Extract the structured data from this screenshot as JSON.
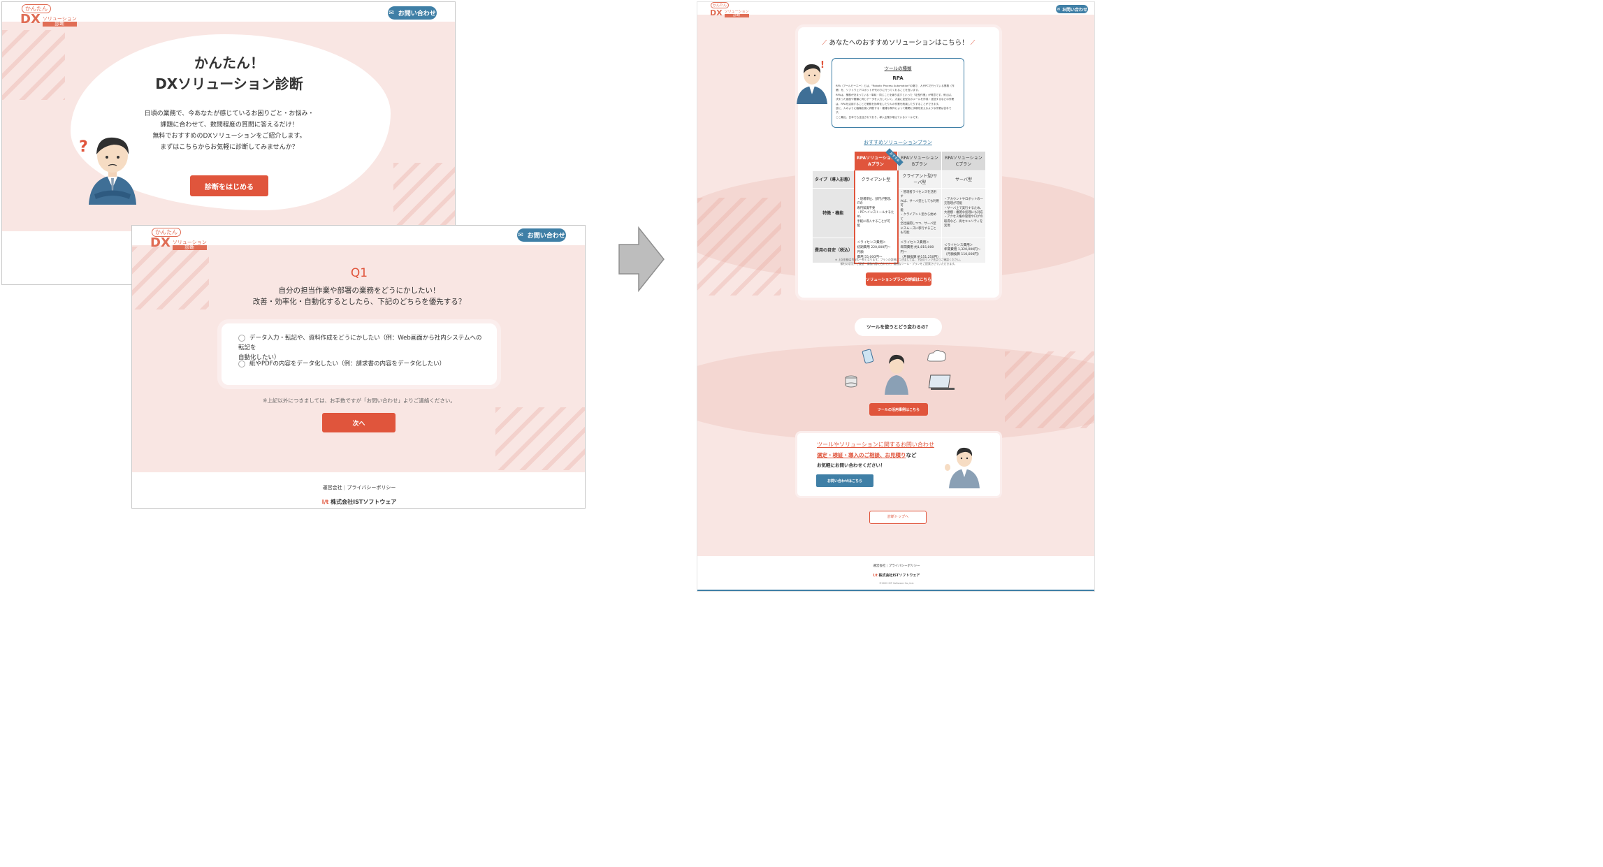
{
  "colors": {
    "accent": "#e0553c",
    "brand_blue": "#3f7fa6",
    "pink_bg": "#f9e6e3",
    "arrow_gray": "#bdbdbd"
  },
  "logo": {
    "tag": "かんたん",
    "dx": "DX",
    "line1": "ソリューション",
    "line2": "診断"
  },
  "contact_label": "お問い合わせ",
  "screen1": {
    "title_line1": "かんたん！",
    "title_line2": "DXソリューション診断",
    "body_lines": [
      "日頃の業務で、今あなたが感じているお困りごと・お悩み・",
      "課題に合わせて、数問程度の質問に答えるだけ！",
      "無料でおすすめのDXソリューションをご紹介します。",
      "まずはこちらからお気軽に診断してみませんか？"
    ],
    "start_button": "診断をはじめる"
  },
  "screen2": {
    "q_number": "Q1",
    "q_line1": "自分の担当作業や部署の業務をどうにかしたい！",
    "q_line2": "改善・効率化・自動化するとしたら、下記のどちらを優先する？",
    "option1_a": "データ入力・転記や、資料作成をどうにかしたい（例：Web画面から社内システムへの転記を",
    "option1_b": "自動化したい）",
    "option2": "紙やPDFの内容をデータ化したい（例：請求書の内容をデータ化したい）",
    "note": "※上記以外につきましては、お手数ですが「お問い合わせ」よりご連絡ください。",
    "next_button": "次へ",
    "footer_company": "運営会社",
    "footer_privacy": "プライバシーポリシー",
    "footer_brand": "株式会社ISTソフトウェア"
  },
  "screen3": {
    "rec_title": "あなたへのおすすめソリューションはこちら！",
    "tool_kind_label": "ツールの種類",
    "tool_name": "RPA",
    "tool_desc": [
      "RPA（アールピーエー）とは、\"Robotic Process Automation\"の略で、人がPCで行っている業務（作",
      "業）を、ソフトウェアロボットが代わりに行ってくれることを言います。",
      "RPAは、業務が決まっている・単純・同じことを繰り返すといった「定型作業」が得意です。例えば、",
      "決まった画面や書類に同じデータを入力していく、大量に定型文のメールを作成・送信するなどの作業",
      "は、RPAを活用することで業務を効率化したり人の作業を削減したりすることができます。",
      "逆に、人のように臨機応変に判断する・複雑な条件によって難関に手順を変えるような作業は苦手で",
      "す。",
      "ここ最近、日本でも注目されており、導入企業が増えているツールです。"
    ],
    "plans_title": "おすすめソリューションプラン",
    "plan_headers": [
      "RPAソリューション\nAプラン",
      "RPAソリューション\nBプラン",
      "RPAソリューション\nCプラン"
    ],
    "recommended_badge": "おすすめ",
    "row_labels": [
      "タイプ（導入形態）",
      "特徴・機能",
      "費用の目安（税込）"
    ],
    "type_row": [
      "クライアント型",
      "クライアント型/サーバ型",
      "サーバ型"
    ],
    "feature_row": [
      "・現場単位、部門が整理、ITの\n専門知識不要\n・PCへインストールするため、\n手軽に導入することが可\n能",
      "・管理者ライセンスを活用す\nれば、サーバ型としても利用可\n能\n・クライアント型から始めて\n全社展開しつつ、サーバ型\nにスムーズに移行することも可能",
      "・アカウントやロボットの一\n元管理が可能\n・サーバ上で実行するため、\n大規模・複雑な処理にも対応\n・アクセス権の管理やログの\n取得など、高セキュリティを\n実現"
    ],
    "cost_row": [
      "＜ライセンス費用＞\n初期費用 220,000円〜 月額\n費用 55,000円〜",
      "＜ライセンス費用＞\n年間費用 約1,815,000円〜\n（月額換算 約151,250円）",
      "＜ライセンス費用＞\n年間費用 1,320,000円〜\n（月額換算 110,000円）"
    ],
    "plans_note1": "※ 上記金額は目安の一例となります。プランの詳細につきましては、下記のリンク先よりご確認ください。",
    "plans_note2": "御社の状況やご要望・業務内容に合わせた、最適なツール・プランをご提案させていただきます。",
    "plans_detail_button": "ソリューションプランの詳細はこちら",
    "bubble": "ツールを使うとどう変わるの？",
    "usecase_button": "ツールの活用事例はこちら",
    "contact_heading": "ツールやソリューションに関するお問い合わせ",
    "contact_line2_highlight": "選定・検証・導入のご相談、お見積り",
    "contact_line2_tail": "など",
    "contact_line3": "お気軽にお問い合わせください！",
    "contact_button": "お問い合わせはこちら",
    "top_button": "診断トップへ",
    "footer_company": "運営会社",
    "footer_privacy": "プライバシーポリシー",
    "footer_brand": "株式会社ISTソフトウェア",
    "copyright": "©2022 IST Software Co.,Ltd."
  }
}
